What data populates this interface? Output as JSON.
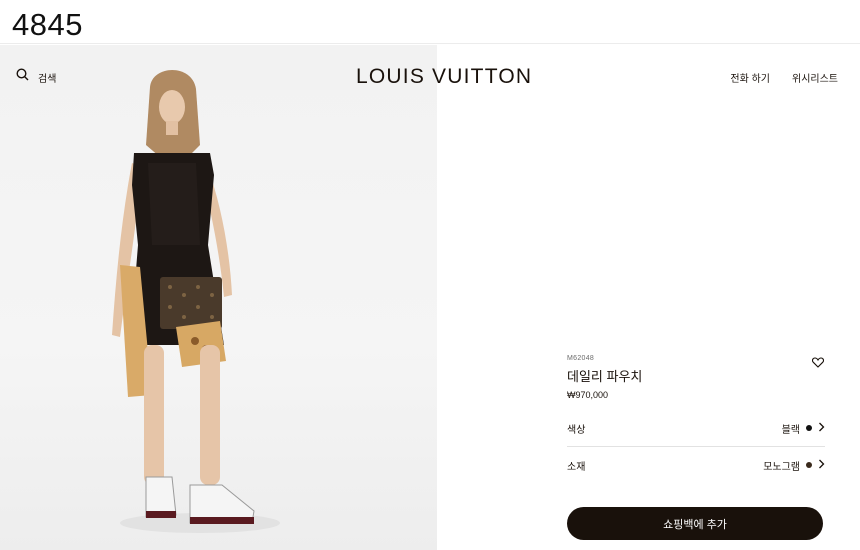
{
  "frame_label": "4845",
  "header": {
    "search_label": "검색",
    "logo": "LOUIS VUITTON",
    "call_label": "전화 하기",
    "wishlist_label": "위시리스트"
  },
  "product": {
    "sku": "M62048",
    "name": "데일리 파우치",
    "price": "₩970,000",
    "options": [
      {
        "label": "색상",
        "value": "블랙",
        "swatch": "#111111"
      },
      {
        "label": "소재",
        "value": "모노그램",
        "swatch": "#3a2a1c"
      }
    ],
    "add_to_bag": "쇼핑백에 추가"
  },
  "colors": {
    "brand_dark": "#19110b",
    "background": "#ffffff",
    "image_bg": "#f3f3f3"
  },
  "icons": {
    "search": "search-icon",
    "wishlist": "heart-icon",
    "chevron": "chevron-right-icon"
  }
}
